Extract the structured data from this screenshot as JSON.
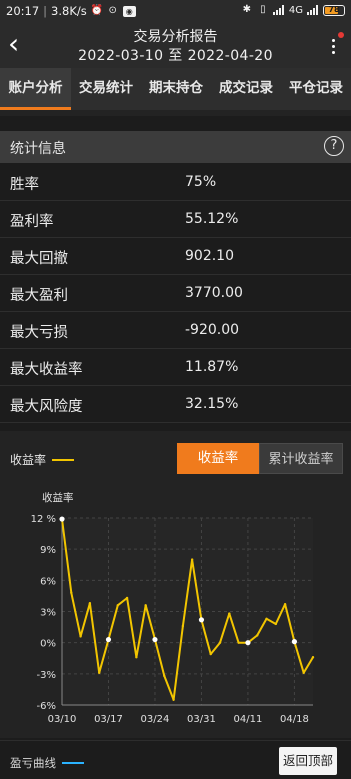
{
  "status_bar": {
    "time": "20:17",
    "speed": "3.8K/s",
    "battery": "78",
    "network": "4G",
    "accent_battery": "#f39b22"
  },
  "header": {
    "title": "交易分析报告",
    "date_from": "2022-03-10",
    "to_word": "至",
    "date_to": "2022-04-20"
  },
  "tabs": [
    {
      "label": "账户分析",
      "active": true
    },
    {
      "label": "交易统计",
      "active": false
    },
    {
      "label": "期末持仓",
      "active": false
    },
    {
      "label": "成交记录",
      "active": false
    },
    {
      "label": "平仓记录",
      "active": false
    }
  ],
  "stats": {
    "title": "统计信息",
    "rows": [
      {
        "label": "胜率",
        "value": "75%"
      },
      {
        "label": "盈利率",
        "value": "55.12%"
      },
      {
        "label": "最大回撤",
        "value": "902.10"
      },
      {
        "label": "最大盈利",
        "value": "3770.00"
      },
      {
        "label": "最大亏损",
        "value": "-920.00"
      },
      {
        "label": "最大收益率",
        "value": "11.87%"
      },
      {
        "label": "最大风险度",
        "value": "32.15%"
      }
    ]
  },
  "chart_panel": {
    "legend": "收益率",
    "toggle_active": "收益率",
    "toggle_other": "累计收益率"
  },
  "chart_data": {
    "type": "line",
    "title": "",
    "ylabel": "收益率",
    "xlabel": "",
    "ylim": [
      -6,
      12
    ],
    "yticks": [
      12,
      9,
      6,
      3,
      0,
      -3,
      -6
    ],
    "ytick_labels": [
      "12 %",
      "9%",
      "6%",
      "3%",
      "0%",
      "-3%",
      "-6%"
    ],
    "x_labels": [
      "03/10",
      "03/17",
      "03/24",
      "03/31",
      "04/11",
      "04/18"
    ],
    "x_label_index": [
      0,
      5,
      10,
      15,
      20,
      25
    ],
    "grid": true,
    "line_color": "#f2c500",
    "series": [
      {
        "values": [
          11.9,
          4.8,
          0.6,
          3.8,
          -2.9,
          0.3,
          3.6,
          4.3,
          -1.4,
          3.6,
          0.3,
          -3.2,
          -5.5,
          1.6,
          8.0,
          2.2,
          -1.1,
          0.0,
          2.8,
          0.0,
          0.0,
          0.7,
          2.3,
          1.8,
          3.7,
          0.1,
          -2.9,
          -1.4
        ],
        "highlight_index": [
          0,
          5,
          10,
          15,
          20,
          25
        ]
      }
    ]
  },
  "footer": {
    "legend": "盈亏曲线",
    "back_top": "返回顶部",
    "legend_color": "#2bb3ff"
  }
}
